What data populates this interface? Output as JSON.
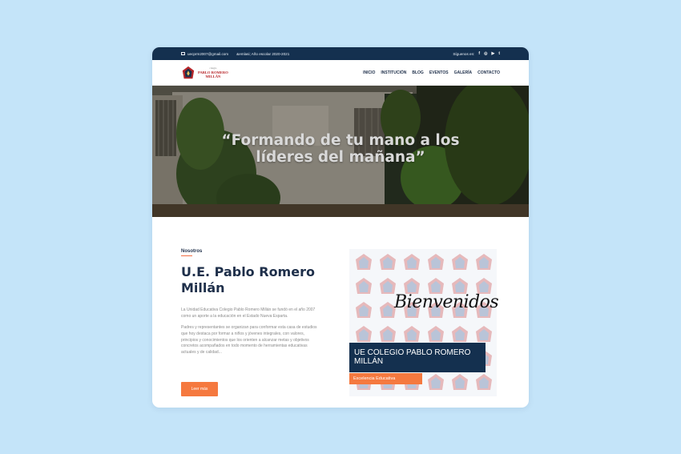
{
  "topbar": {
    "email": "uecprm2007@gmail.com",
    "year": "&emlasi; Año escolar 2020-2021",
    "follow_label": "Síguenos en:",
    "social": [
      "f",
      "◎",
      "▶",
      "t"
    ]
  },
  "logo": {
    "small": "colegio",
    "line1": "PABLO ROMERO",
    "line2": "MILLÁN"
  },
  "menu": [
    "INICIO",
    "INSTITUCIÓN",
    "BLOG",
    "EVENTOS",
    "GALERÍA",
    "CONTACTO"
  ],
  "hero": {
    "quote": "“Formando de tu mano a los líderes del mañana”"
  },
  "about": {
    "eyebrow": "Nosotros",
    "title": "U.E. Pablo Romero Millán",
    "p1": "La Unidad Educativa Colegio Pablo Romero Millán se fundó en el año 2007 como un aporte a la educación en el Estado Nueva Esparta.",
    "p2": "Padres y representantes se organizan para conformar esta casa de estudios que hoy destaca por formar a niños y jóvenes integrales, con valores, principios y conocimientos que los orienten a alcanzar metas y objetivos concretos acompañados en todo momento de herramientas educativas actuales y de calidad...",
    "button": "Leer más"
  },
  "welcome": {
    "script": "Bienvenidos",
    "title": "UE COLEGIO PABLO ROMERO MILLÁN",
    "tag": "Excelencia Educativa"
  },
  "colors": {
    "navy": "#14304f",
    "orange": "#f5793f",
    "background": "#c4e4f9"
  }
}
